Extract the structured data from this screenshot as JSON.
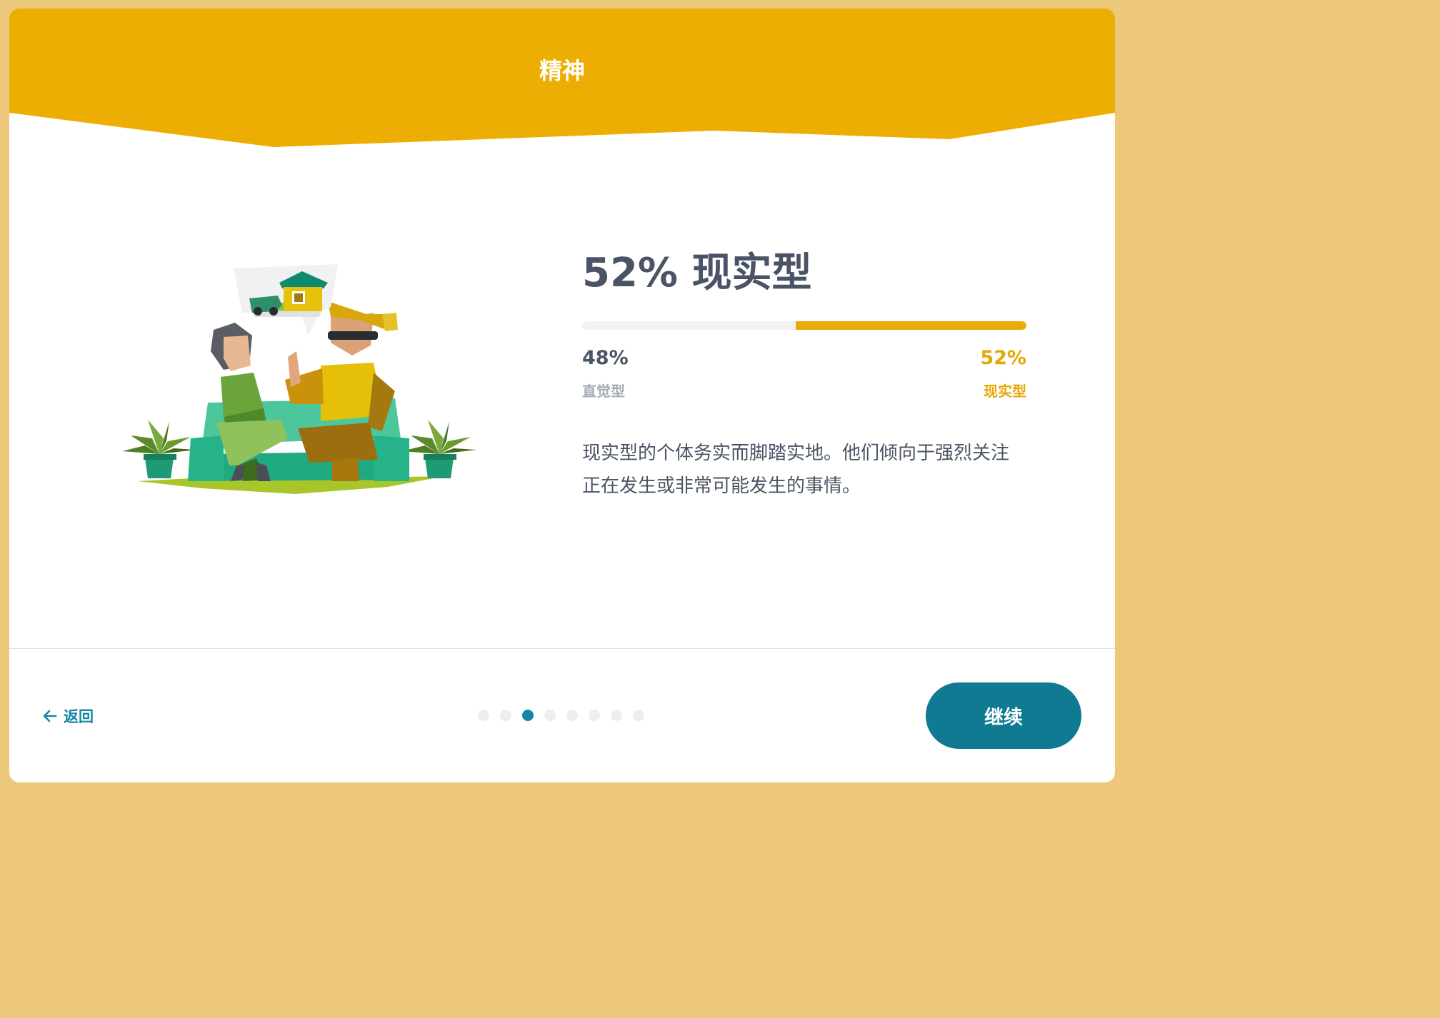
{
  "header": {
    "title": "精神"
  },
  "result": {
    "headline": "52% 现实型",
    "left": {
      "percent": "48%",
      "label": "直觉型",
      "value": 48
    },
    "right": {
      "percent": "52%",
      "label": "现实型",
      "value": 52
    },
    "description": "现实型的个体务实而脚踏实地。他们倾向于强烈关注正在发生或非常可能发生的事情。"
  },
  "footer": {
    "back_label": "返回",
    "continue_label": "继续",
    "pagination": {
      "total": 8,
      "current": 3
    }
  },
  "colors": {
    "header": "#edae03",
    "accent": "#eaaa0a",
    "primary": "#0f7a91",
    "link": "#1587a6",
    "text": "#4b5466"
  },
  "illustration": {
    "subject": "two-people-on-sofa-talking",
    "bubble": "house-and-jeep-icon"
  }
}
